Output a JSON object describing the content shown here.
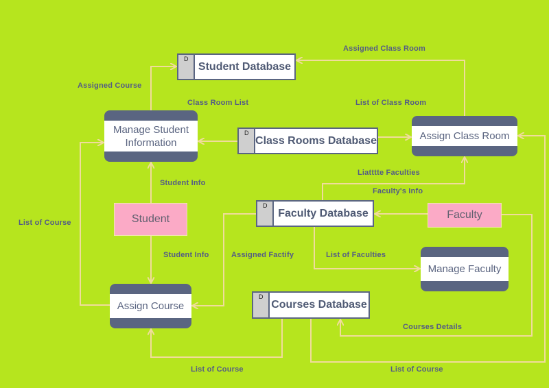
{
  "colors": {
    "background": "#b6e51e",
    "process_band": "#5a6581",
    "entity": "#fbaac6",
    "flow_line": "#f0dc9c",
    "label": "#545c85"
  },
  "data_stores": {
    "marker": "D",
    "student_db": "Student Database",
    "classrooms_db": "Class Rooms Database",
    "faculty_db": "Faculty Database",
    "courses_db": "Courses Database"
  },
  "processes": {
    "manage_student": "Manage Student Information",
    "assign_class_room": "Assign Class Room",
    "assign_course": "Assign Course",
    "manage_faculty": "Manage Faculty"
  },
  "entities": {
    "student": "Student",
    "faculty": "Faculty"
  },
  "flows": {
    "assigned_course": "Assigned Course",
    "class_room_list": "Class Room List",
    "list_of_class_room": "List of Class Room",
    "assigned_class_room": "Assigned Class Room",
    "student_info_up": "Student Info",
    "student_info_down": "Student Info",
    "list_of_course_left": "List of Course",
    "assigned_factify": "Assigned Factify",
    "liatttte_faculties": "Liatttte Faculties",
    "facultys_info": "Faculty's Info",
    "list_of_faculties": "List of Faculties",
    "courses_details": "Courses Details",
    "list_of_course_bottom_left": "List of Course",
    "list_of_course_bottom_right": "List of Course"
  }
}
